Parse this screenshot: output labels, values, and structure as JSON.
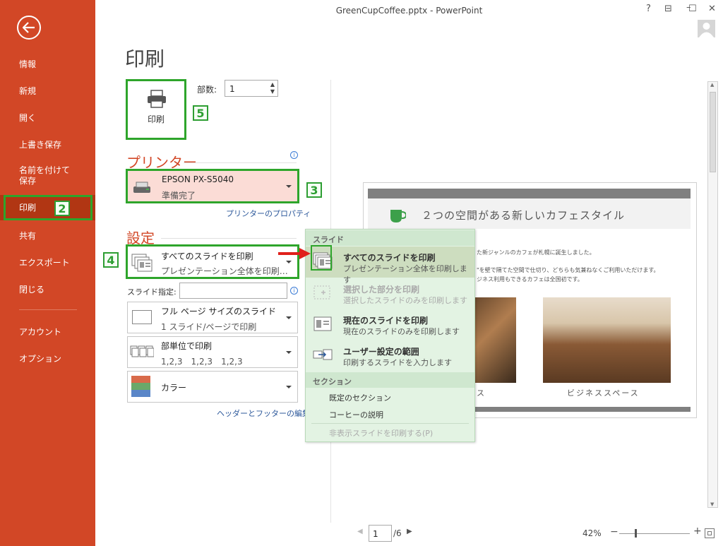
{
  "window": {
    "title": "GreenCupCoffee.pptx - PowerPoint",
    "help": "?",
    "ribbon_btn": "⊟",
    "minimize": "–",
    "maximize": "☐",
    "close": "✕"
  },
  "sidebar": {
    "items": [
      {
        "label": "情報"
      },
      {
        "label": "新規"
      },
      {
        "label": "開く"
      },
      {
        "label": "上書き保存"
      },
      {
        "label": "名前を付けて\n保存"
      },
      {
        "label": "印刷"
      },
      {
        "label": "共有"
      },
      {
        "label": "エクスポート"
      },
      {
        "label": "閉じる"
      },
      {
        "label": "アカウント"
      },
      {
        "label": "オプション"
      }
    ]
  },
  "callouts": {
    "c2": "2",
    "c3": "3",
    "c4": "4",
    "c5": "5"
  },
  "page": {
    "title": "印刷"
  },
  "print": {
    "button_label": "印刷",
    "copies_label": "部数:",
    "copies_value": "1"
  },
  "printer": {
    "section_title": "プリンター",
    "name": "EPSON PX-S5040",
    "status": "準備完了",
    "properties_link": "プリンターのプロパティ"
  },
  "settings": {
    "section_title": "設定",
    "range": {
      "title": "すべてのスライドを印刷",
      "subtitle": "プレゼンテーション全体を印刷…"
    },
    "slides_label": "スライド指定:",
    "slides_value": "",
    "layout": {
      "title": "フル ページ サイズのスライド",
      "subtitle": "1 スライド/ページで印刷"
    },
    "collate": {
      "title": "部単位で印刷",
      "subtitle": "1,2,3　1,2,3　1,2,3"
    },
    "color": {
      "title": "カラー"
    },
    "header_footer_link": "ヘッダーとフッターの編集"
  },
  "menu": {
    "slides_header": "スライド",
    "items": [
      {
        "title": "すべてのスライドを印刷",
        "subtitle": "プレゼンテーション全体を印刷します"
      },
      {
        "title": "選択した部分を印刷",
        "subtitle": "選択したスライドのみを印刷します"
      },
      {
        "title": "現在のスライドを印刷",
        "subtitle": "現在のスライドのみを印刷します"
      },
      {
        "title": "ユーザー設定の範囲",
        "subtitle": "印刷するスライドを入力します"
      }
    ],
    "section_header": "セクション",
    "sections": [
      {
        "label": "既定のセクション"
      },
      {
        "label": "コーヒーの説明"
      }
    ],
    "hidden_label": "非表示スライドを印刷する(P)"
  },
  "slide": {
    "heading": "２つの空間がある新しいカフェスタイル",
    "line1": "た新ジャンルのカフェが札幌に誕生しました。",
    "line2": "\"を壁で隔てた空間で仕切り、どちらも気兼ねなくご利用いただけます。",
    "line3": "ジネス利用もできるカフェは全国初です。",
    "caption_left": "ス",
    "caption_right": "ビジネススペース"
  },
  "footer": {
    "page_value": "1",
    "page_total": "/6",
    "zoom": "42%",
    "zoom_minus": "−",
    "zoom_plus": "+"
  },
  "colors": {
    "sidebar": "#d24726",
    "selected": "#b13613",
    "callout": "#2e9e33",
    "printer_bg": "#fbdcd6",
    "menu_bg": "#e3f3e3"
  }
}
